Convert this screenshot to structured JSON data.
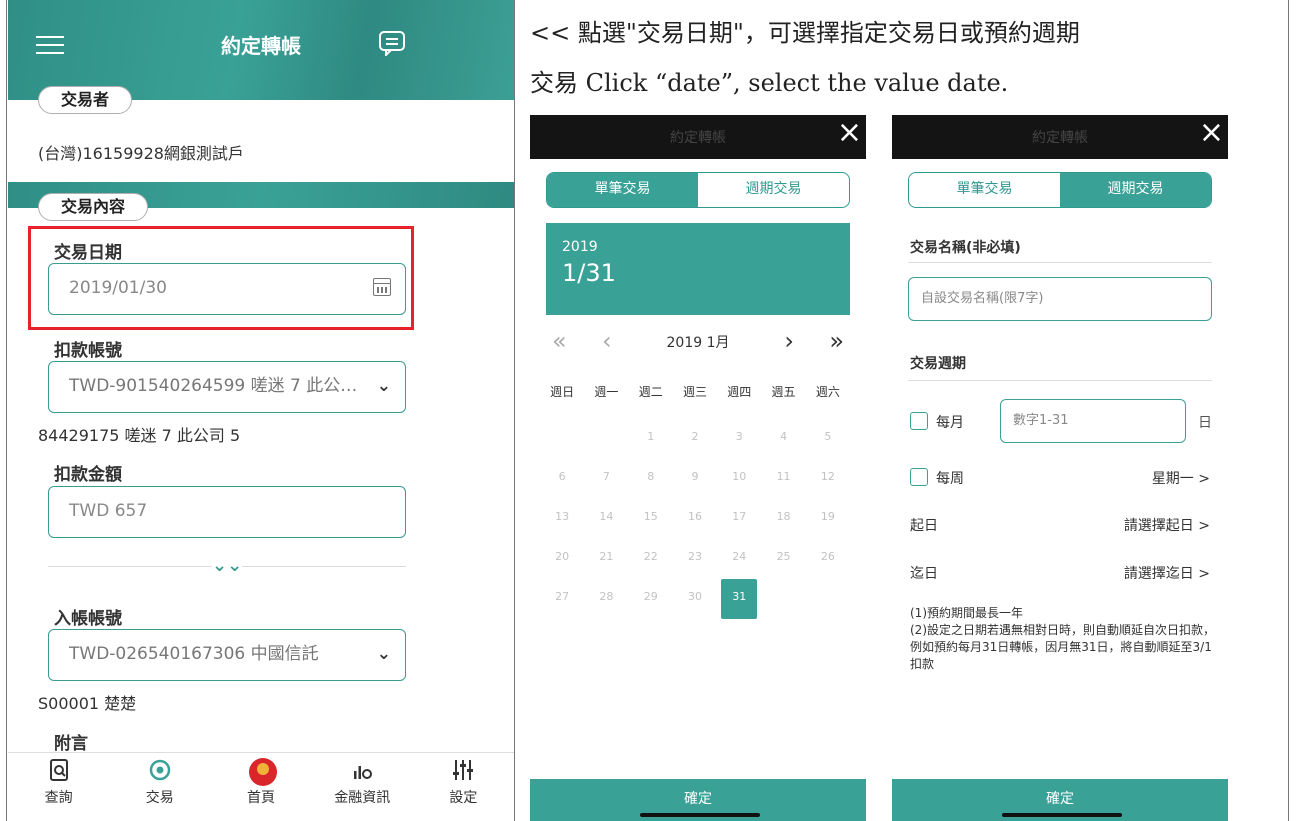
{
  "left_phone": {
    "title": "約定轉帳",
    "trader_tag": "交易者",
    "trader_value": "(台灣)16159928網銀測試戶",
    "content_tag": "交易內容",
    "date_label": "交易日期",
    "date_value": "2019/01/30",
    "debit_account_label": "扣款帳號",
    "debit_account_value": "TWD-901540264599 嗟迷 7 此公…",
    "debit_account_sub": "84429175 嗟迷 7 此公司 5",
    "amount_label": "扣款金額",
    "amount_value": "TWD 657",
    "credit_account_label": "入帳帳號",
    "credit_account_value": "TWD-026540167306 中國信託",
    "credit_account_sub": "S00001 楚楚",
    "note_label": "附言",
    "tabs": [
      {
        "label": "查詢",
        "icon": "search-doc-icon"
      },
      {
        "label": "交易",
        "icon": "transaction-icon"
      },
      {
        "label": "首頁",
        "icon": "home-logo-icon"
      },
      {
        "label": "金融資訊",
        "icon": "finance-info-icon"
      },
      {
        "label": "設定",
        "icon": "settings-sliders-icon"
      }
    ]
  },
  "caption": {
    "line1": "<< 點選\"交易日期\"，可選擇指定交易日或預約週期",
    "line2": "交易 Click “date”, select the value date."
  },
  "calendar_modal": {
    "ghost_title": "約定轉帳",
    "close": "×",
    "seg_single": "單筆交易",
    "seg_periodic": "週期交易",
    "year": "2019",
    "selected": "1/31",
    "month": "2019 1月",
    "nav_first": "«",
    "nav_prev": "‹",
    "nav_next": "›",
    "nav_last": "»",
    "weekdays": [
      "週日",
      "週一",
      "週二",
      "週三",
      "週四",
      "週五",
      "週六"
    ],
    "days": [
      "",
      "",
      "1",
      "2",
      "3",
      "4",
      "5",
      "6",
      "7",
      "8",
      "9",
      "10",
      "11",
      "12",
      "13",
      "14",
      "15",
      "16",
      "17",
      "18",
      "19",
      "20",
      "21",
      "22",
      "23",
      "24",
      "25",
      "26",
      "27",
      "28",
      "29",
      "30",
      "31"
    ],
    "selected_day": "31",
    "confirm": "確定"
  },
  "periodic_modal": {
    "ghost_title": "約定轉帳",
    "close": "×",
    "seg_single": "單筆交易",
    "seg_periodic": "週期交易",
    "name_label": "交易名稱(非必填)",
    "name_placeholder": "自設交易名稱(限7字)",
    "cycle_label": "交易週期",
    "monthly_label": "每月",
    "monthly_placeholder": "數字1-31",
    "day_unit": "日",
    "weekly_label": "每周",
    "weekly_value": "星期一 >",
    "start_label": "起日",
    "start_value": "請選擇起日 >",
    "end_label": "迄日",
    "end_value": "請選擇迄日 >",
    "note1": "(1)預約期間最長一年",
    "note2": "(2)設定之日期若遇無相對日時，則自動順延自次日扣款，例如預約每月31日轉帳，因月無31日，將自動順延至3/1扣款",
    "confirm": "確定"
  }
}
